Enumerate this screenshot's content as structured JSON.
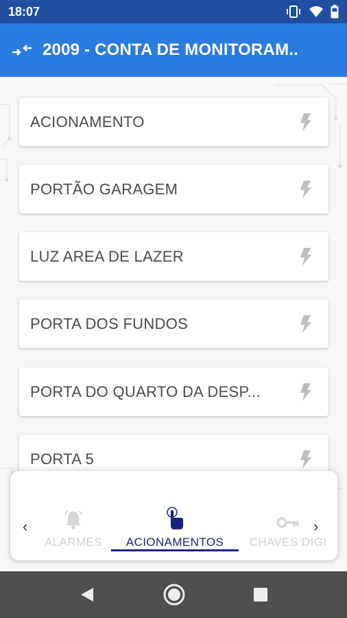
{
  "status_bar": {
    "time": "18:07",
    "icons": [
      "vibrate-icon",
      "wifi-icon",
      "battery-icon"
    ]
  },
  "app_bar": {
    "title": "2009 - CONTA DE MONITORAM..",
    "icon": "swap-arrows-icon"
  },
  "actions": [
    {
      "label": "ACIONAMENTO",
      "icon": "bolt-icon"
    },
    {
      "label": "PORTÃO GARAGEM",
      "icon": "bolt-icon"
    },
    {
      "label": "LUZ AREA DE LAZER",
      "icon": "bolt-icon"
    },
    {
      "label": "PORTA DOS FUNDOS",
      "icon": "bolt-icon"
    },
    {
      "label": "PORTA DO QUARTO DA DESP...",
      "icon": "bolt-icon"
    },
    {
      "label": "PORTA 5",
      "icon": "bolt-icon"
    }
  ],
  "tabs": [
    {
      "label": "ALARMES",
      "icon": "bell-icon",
      "active": false
    },
    {
      "label": "ACIONAMENTOS",
      "icon": "touch-hand-icon",
      "active": true
    },
    {
      "label": "CHAVES DIGI",
      "icon": "key-icon",
      "active": false
    }
  ],
  "nav": {
    "icons": [
      "back-triangle-icon",
      "home-circle-icon",
      "recents-square-icon"
    ]
  },
  "colors": {
    "status_bar": "#1e4fa1",
    "app_bar": "#2a7be0",
    "active_tab": "#1a237e",
    "inactive_tab": "#d0d0d0",
    "bolt": "#bdbdbd"
  }
}
